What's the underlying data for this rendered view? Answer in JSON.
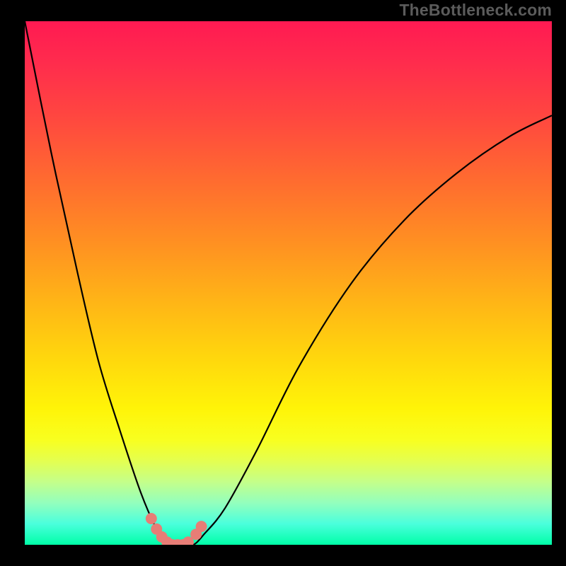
{
  "watermark": "TheBottleneck.com",
  "chart_data": {
    "type": "line",
    "title": "",
    "xlabel": "",
    "ylabel": "",
    "xlim": [
      0,
      100
    ],
    "ylim": [
      0,
      100
    ],
    "grid": false,
    "legend": false,
    "background_gradient": {
      "top": "#ff1a52",
      "bottom": "#00ffa8"
    },
    "series": [
      {
        "name": "bottleneck-curve",
        "color": "#000000",
        "x": [
          0,
          5,
          10,
          14,
          18,
          22,
          25,
          26.5,
          28,
          30,
          32,
          34,
          38,
          44,
          52,
          62,
          72,
          82,
          92,
          100
        ],
        "y": [
          100,
          75,
          52,
          35,
          22,
          10,
          3,
          1,
          0,
          0,
          0,
          2,
          7,
          18,
          34,
          50,
          62,
          71,
          78,
          82
        ]
      },
      {
        "name": "highlight-points",
        "type": "scatter",
        "color": "#e77d76",
        "x": [
          24,
          25,
          26,
          27,
          28,
          29,
          30,
          31,
          32.5,
          33.5
        ],
        "y": [
          5,
          3,
          1.5,
          0.5,
          0,
          0,
          0,
          0.5,
          2,
          3.5
        ]
      }
    ]
  }
}
